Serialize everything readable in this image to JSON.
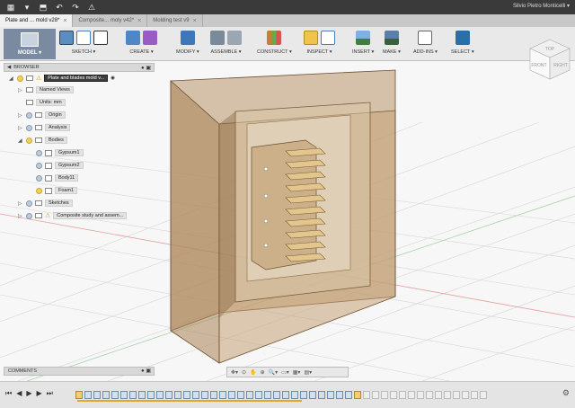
{
  "window": {
    "user_name": "Silvio Pietro Monticelli ▾",
    "quick_access": [
      "▦",
      "▾",
      "⬒",
      "↶",
      "↷",
      "⚠"
    ]
  },
  "tabs": [
    {
      "label": "Plate and ... mold v28*",
      "active": true
    },
    {
      "label": "Composite... moly v42*",
      "active": false
    },
    {
      "label": "Molding test v9",
      "active": false
    }
  ],
  "toolbar": {
    "workspace": "MODEL ▾",
    "groups": [
      {
        "label": "SKETCH ▾"
      },
      {
        "label": "CREATE ▾"
      },
      {
        "label": "MODIFY ▾"
      },
      {
        "label": "ASSEMBLE ▾"
      },
      {
        "label": "CONSTRUCT ▾"
      },
      {
        "label": "INSPECT ▾"
      },
      {
        "label": "INSERT ▾"
      },
      {
        "label": "MAKE ▾"
      },
      {
        "label": "ADD-INS ▾"
      },
      {
        "label": "SELECT ▾"
      }
    ]
  },
  "browser": {
    "title": "BROWSER",
    "root": "Plate and blades mold v...",
    "items": [
      {
        "label": "Named Views"
      },
      {
        "label": "Units: mm"
      },
      {
        "label": "Origin"
      },
      {
        "label": "Analysis"
      },
      {
        "label": "Bodies"
      },
      {
        "label": "Gypsum1"
      },
      {
        "label": "Gypsum2"
      },
      {
        "label": "Body11"
      },
      {
        "label": "Foam1"
      },
      {
        "label": "Sketches"
      },
      {
        "label": "Composite study and assem..."
      }
    ]
  },
  "viewcube": {
    "top_label": "TOP",
    "front_label": "FRONT",
    "right_label": "RIGHT"
  },
  "comments": {
    "title": "COMMENTS"
  },
  "navbar": {
    "icons": [
      "✥▾",
      "⊙",
      "✋",
      "⊕",
      "🔍▾",
      "▭▾",
      "▦▾",
      "▤▾"
    ]
  },
  "timeline": {
    "controls": [
      "⏮",
      "◀",
      "▶",
      "▶",
      "⏭"
    ],
    "settings_icon": "⚙"
  },
  "colors": {
    "mold_fill": "#b9956a",
    "mold_dark": "#8a6a44",
    "grid_line": "#d6d6d6",
    "select_accent": "#2b6fa8"
  }
}
